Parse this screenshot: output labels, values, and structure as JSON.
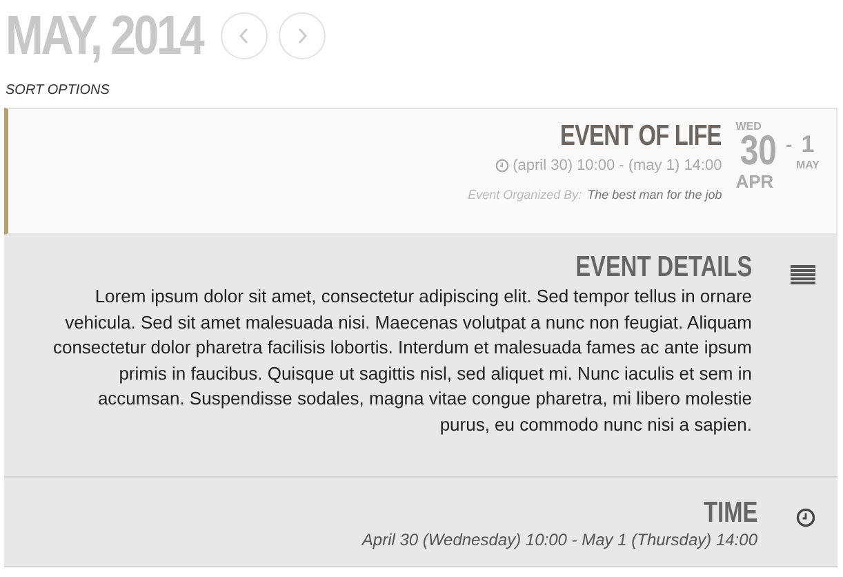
{
  "header": {
    "month": "MAY, 2014",
    "sort_label": "SORT OPTIONS"
  },
  "event": {
    "title": "EVENT OF LIFE",
    "time": "(april 30) 10:00 - (may 1) 14:00",
    "organizer_label": "Event Organized By:",
    "organizer": "The best man for the job",
    "start_weekday": "WED",
    "start_day": "30",
    "start_month": "APR",
    "separator": "-",
    "end_day": "1",
    "end_month": "MAY"
  },
  "sections": [
    {
      "kind": "details",
      "title": "EVENT DETAILS",
      "body": "Lorem ipsum dolor sit amet, consectetur adipiscing elit. Sed tempor tellus in ornare vehicula. Sed sit amet malesuada nisi. Maecenas volutpat a nunc non feugiat. Aliquam consectetur dolor pharetra facilisis lobortis. Interdum et malesuada fames ac ante ipsum primis in faucibus. Quisque ut sagittis nisl, sed aliquet mi. Nunc iaculis et sem in accumsan. Suspendisse sodales, magna vitae congue pharetra, mi libero molestie purus, eu commodo nunc nisi a sapien."
    },
    {
      "kind": "time",
      "title": "TIME",
      "body": "April 30 (Wednesday) 10:00 - May 1 (Thursday) 14:00"
    }
  ]
}
